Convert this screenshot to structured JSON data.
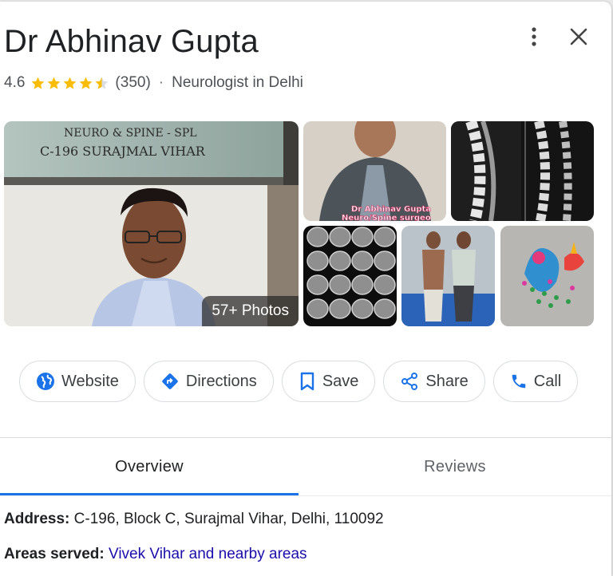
{
  "header": {
    "title": "Dr Abhinav Gupta",
    "rating": "4.6",
    "review_count": "(350)",
    "separator": "·",
    "category": "Neurologist in Delhi",
    "stars": 4.5
  },
  "photos": {
    "badge": "57+ Photos",
    "sign_line1": "NEURO & SPINE - SPL",
    "sign_line2": "C-196 SURAJMAL VIHAR",
    "video_caption1": "Dr Abhinav Gupta",
    "video_caption2": "Neuro/Spine surgeo"
  },
  "actions": {
    "website": "Website",
    "directions": "Directions",
    "save": "Save",
    "share": "Share",
    "call": "Call"
  },
  "tabs": {
    "overview": "Overview",
    "reviews": "Reviews"
  },
  "info": {
    "address_label": "Address:",
    "address_value": "C-196, Block C, Surajmal Vihar, Delhi, 110092",
    "areas_label": "Areas served:",
    "areas_value": "Vivek Vihar and nearby areas"
  },
  "colors": {
    "accent": "#1a73e8",
    "star": "#fbbc04",
    "link": "#1a0dab"
  }
}
